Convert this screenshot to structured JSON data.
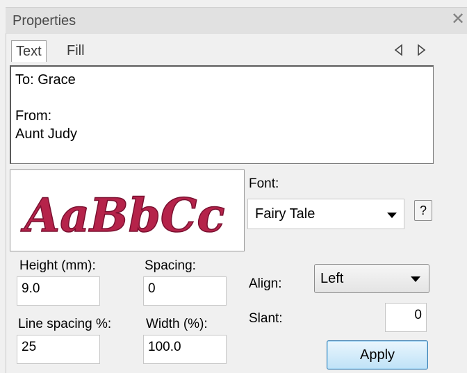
{
  "panel": {
    "title": "Properties",
    "close_icon": "close-icon"
  },
  "tabs": [
    {
      "label": "Text",
      "active": true
    },
    {
      "label": "Fill",
      "active": false
    }
  ],
  "nav": {
    "prev_icon": "triangle-left-icon",
    "next_icon": "triangle-right-icon"
  },
  "text_content": {
    "lines": [
      "To: Grace",
      "",
      "From:",
      "Aunt Judy"
    ]
  },
  "preview": {
    "sample": "AaBbCc",
    "color": "#b5234a"
  },
  "font": {
    "label": "Font:",
    "value": "Fairy Tale",
    "help_label": "?"
  },
  "height": {
    "label": "Height (mm):",
    "value": "9.0"
  },
  "spacing": {
    "label": "Spacing:",
    "value": "0"
  },
  "line_spacing": {
    "label": "Line spacing %:",
    "value": "25"
  },
  "width": {
    "label": "Width (%):",
    "value": "100.0"
  },
  "align": {
    "label": "Align:",
    "value": "Left"
  },
  "slant": {
    "label": "Slant:",
    "value": "0"
  },
  "apply": {
    "label": "Apply"
  }
}
